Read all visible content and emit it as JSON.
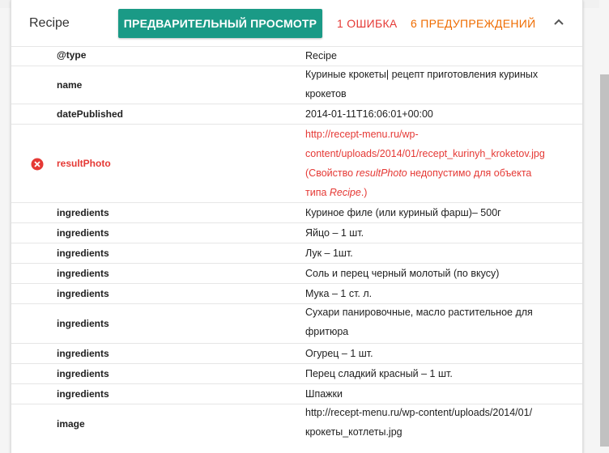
{
  "header": {
    "title": "Recipe",
    "preview_label": "ПРЕДВАРИТЕЛЬНЫЙ ПРОСМОТР",
    "errors_label": "1 ОШИБКА",
    "warnings_label": "6 ПРЕДУПРЕЖДЕНИЙ"
  },
  "rows": [
    {
      "prop": "@type",
      "value": "Recipe"
    },
    {
      "prop": "name",
      "value_lines": [
        "Куриные крокеты| рецепт приготовления куриных",
        "крокетов"
      ]
    },
    {
      "prop": "datePublished",
      "value": "2014-01-11T16:06:01+00:00"
    },
    {
      "prop": "resultPhoto",
      "error": true,
      "value_lines": [
        "http://recept-menu.ru/wp-",
        "content/uploads/2014/01/recept_kurinyh_kroketov.jpg"
      ],
      "note_prefix": "(Свойство ",
      "note_prop": "resultPhoto",
      "note_middle": " недопустимо для объекта",
      "note_line2_prefix": "типа ",
      "note_type": "Recipe",
      "note_suffix": ".)"
    },
    {
      "prop": "ingredients",
      "value": "Куриное филе (или куриный фарш)– 500г"
    },
    {
      "prop": "ingredients",
      "value": "Яйцо – 1 шт."
    },
    {
      "prop": "ingredients",
      "value": "Лук – 1шт."
    },
    {
      "prop": "ingredients",
      "value": "Соль и перец черный молотый (по вкусу)"
    },
    {
      "prop": "ingredients",
      "value": "Мука – 1 ст. л."
    },
    {
      "prop": "ingredients",
      "value_lines": [
        "Сухари панировочные, масло растительное для",
        "фритюра"
      ]
    },
    {
      "prop": "ingredients",
      "value": "Огурец – 1 шт."
    },
    {
      "prop": "ingredients",
      "value": "Перец сладкий красный – 1 шт."
    },
    {
      "prop": "ingredients",
      "value": "Шпажки"
    },
    {
      "prop": "image",
      "value_lines": [
        "http://recept-menu.ru/wp-content/uploads/2014/01/",
        "крокеты_котлеты.jpg"
      ]
    }
  ],
  "colors": {
    "accent": "#1a9a86",
    "error": "#e53935",
    "warning": "#ef6c00"
  },
  "icons": {
    "error": "error-circle-icon",
    "collapse": "chevron-up-icon"
  }
}
